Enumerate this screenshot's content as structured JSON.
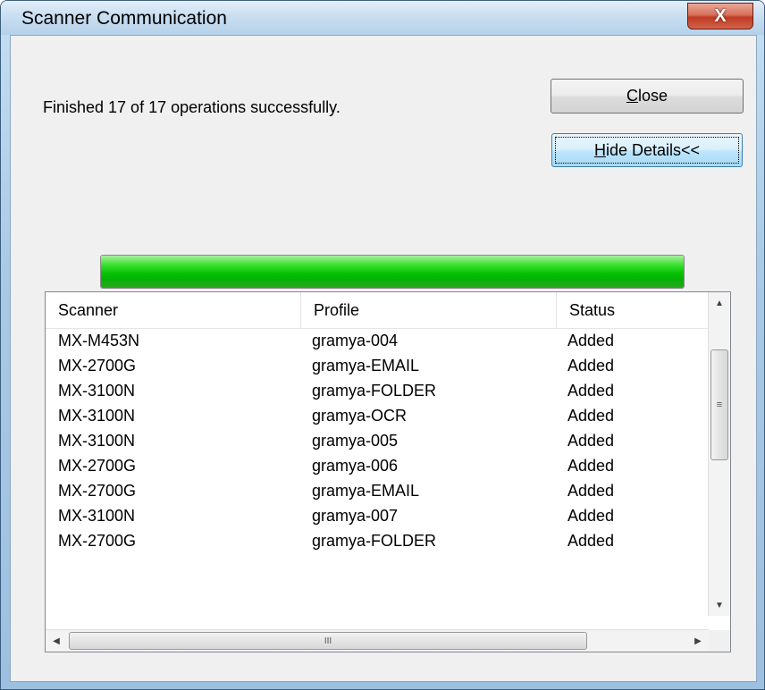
{
  "window": {
    "title": "Scanner Communication",
    "close_glyph": "X"
  },
  "status_message": "Finished 17 of 17 operations successfully.",
  "buttons": {
    "close": {
      "mnemonic": "C",
      "rest": "lose"
    },
    "hide_details": {
      "mnemonic": "H",
      "rest": "ide Details<<"
    }
  },
  "progress": {
    "fraction": 1.0,
    "color": "#06c106"
  },
  "table": {
    "columns": [
      "Scanner",
      "Profile",
      "Status"
    ],
    "rows": [
      [
        "MX-M453N",
        "gramya-004",
        "Added"
      ],
      [
        "MX-2700G",
        "gramya-EMAIL",
        "Added"
      ],
      [
        "MX-3100N",
        "gramya-FOLDER",
        "Added"
      ],
      [
        "MX-3100N",
        "gramya-OCR",
        "Added"
      ],
      [
        "MX-3100N",
        "gramya-005",
        "Added"
      ],
      [
        "MX-2700G",
        "gramya-006",
        "Added"
      ],
      [
        "MX-2700G",
        "gramya-EMAIL",
        "Added"
      ],
      [
        "MX-3100N",
        "gramya-007",
        "Added"
      ],
      [
        "MX-2700G",
        "gramya-FOLDER",
        "Added"
      ]
    ]
  },
  "scrollbar": {
    "up": "▲",
    "down": "▼",
    "left": "◀",
    "right": "▶",
    "v_grip": "≡",
    "h_grip": "III"
  }
}
